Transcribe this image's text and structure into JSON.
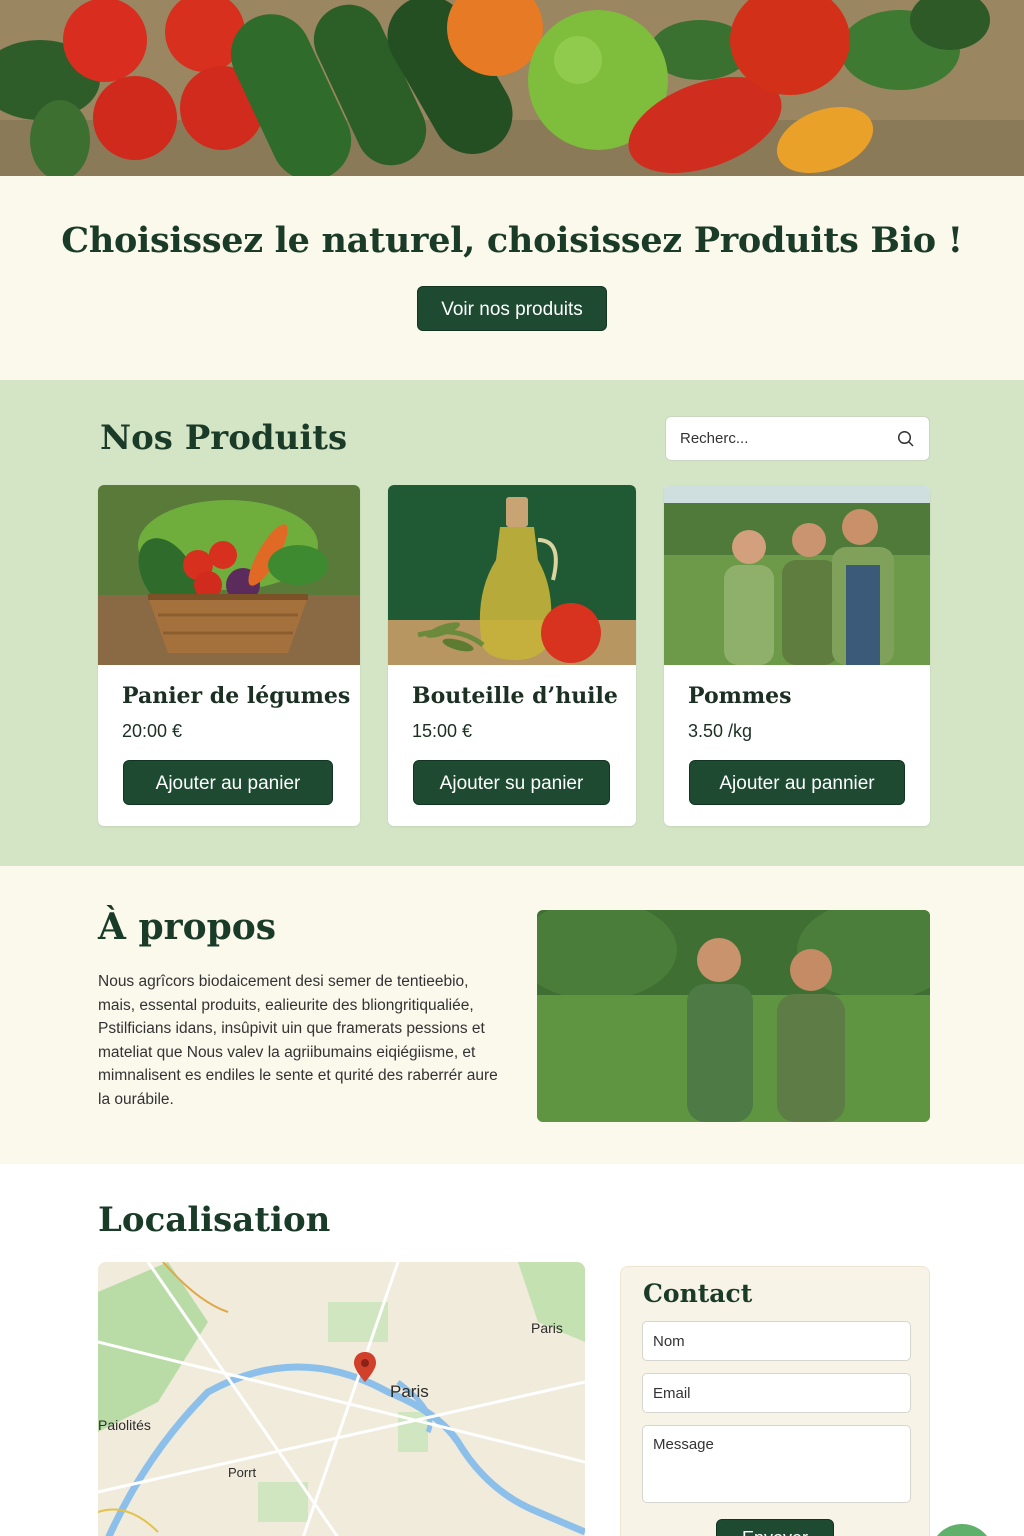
{
  "hero": {
    "title": "Choisissez le naturel, choisissez Produits Bio !",
    "cta_label": "Voir nos produits"
  },
  "products": {
    "title": "Nos Produits",
    "search_placeholder": "Recherc...",
    "items": [
      {
        "name": "Panier de légumes",
        "price": "20:00 €",
        "button": "Ajouter au panier"
      },
      {
        "name": "Bouteille d’huile",
        "price": "15:00 €",
        "button": "Ajouter su panier"
      },
      {
        "name": "Pommes",
        "price": "3.50 /kg",
        "button": "Ajouter au pannier"
      }
    ]
  },
  "about": {
    "title": "À propos",
    "text": "Nous agrîcors biodaicement desi semer de tentieebio, mais, essental  produits, ealieurite des bliongritiqualiée, Pstilficians idans, insûpivit uin que framerats pessions et mateliat que Nous valev la agriibumains eiqiégiisme, et mimnalisent es endiles le sente et qurité des raberrér aure la ourábile."
  },
  "location": {
    "title": "Localisation",
    "map_labels": {
      "paris_top": "Paris",
      "paris_center": "Paris",
      "left": "Paiolités",
      "bottom": "Porrt"
    }
  },
  "contact": {
    "title": "Contact",
    "name_placeholder": "Nom",
    "email_placeholder": "Email",
    "message_placeholder": "Message",
    "send_label": "Envoyer"
  },
  "colors": {
    "brand_dark": "#1d4a31",
    "products_bg": "#d4e5c6",
    "cream": "#fbf8ec"
  }
}
